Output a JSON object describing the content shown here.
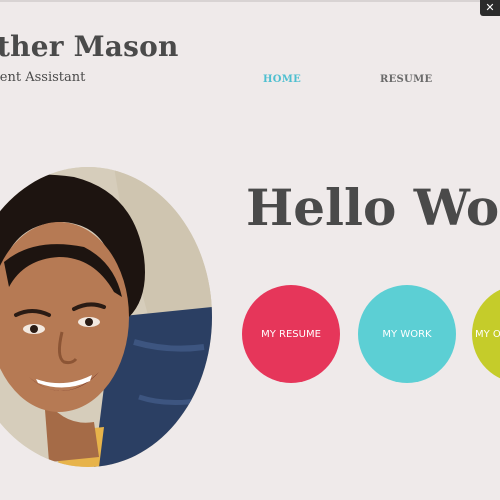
{
  "header": {
    "name": "Heather Mason",
    "tagline": "Development Assistant"
  },
  "nav": {
    "items": [
      {
        "label": "HOME",
        "active": true
      },
      {
        "label": "RESUME",
        "active": false
      }
    ]
  },
  "corner_button": {
    "icon": "close-icon",
    "glyph": "✕"
  },
  "hero": {
    "greeting": "Hello World",
    "buttons": [
      {
        "label": "MY RESUME",
        "color": "#e6365a"
      },
      {
        "label": "MY WORK",
        "color": "#5ccfd4"
      },
      {
        "label": "MY OTHER",
        "color": "#c5cc2a"
      }
    ]
  },
  "colors": {
    "background": "#efeaea",
    "text": "#4a4a4a",
    "nav_active": "#4ebfd0",
    "nav_inactive": "#6a6a6a"
  },
  "profile_photo": {
    "alt": "Portrait of Heather Mason"
  }
}
